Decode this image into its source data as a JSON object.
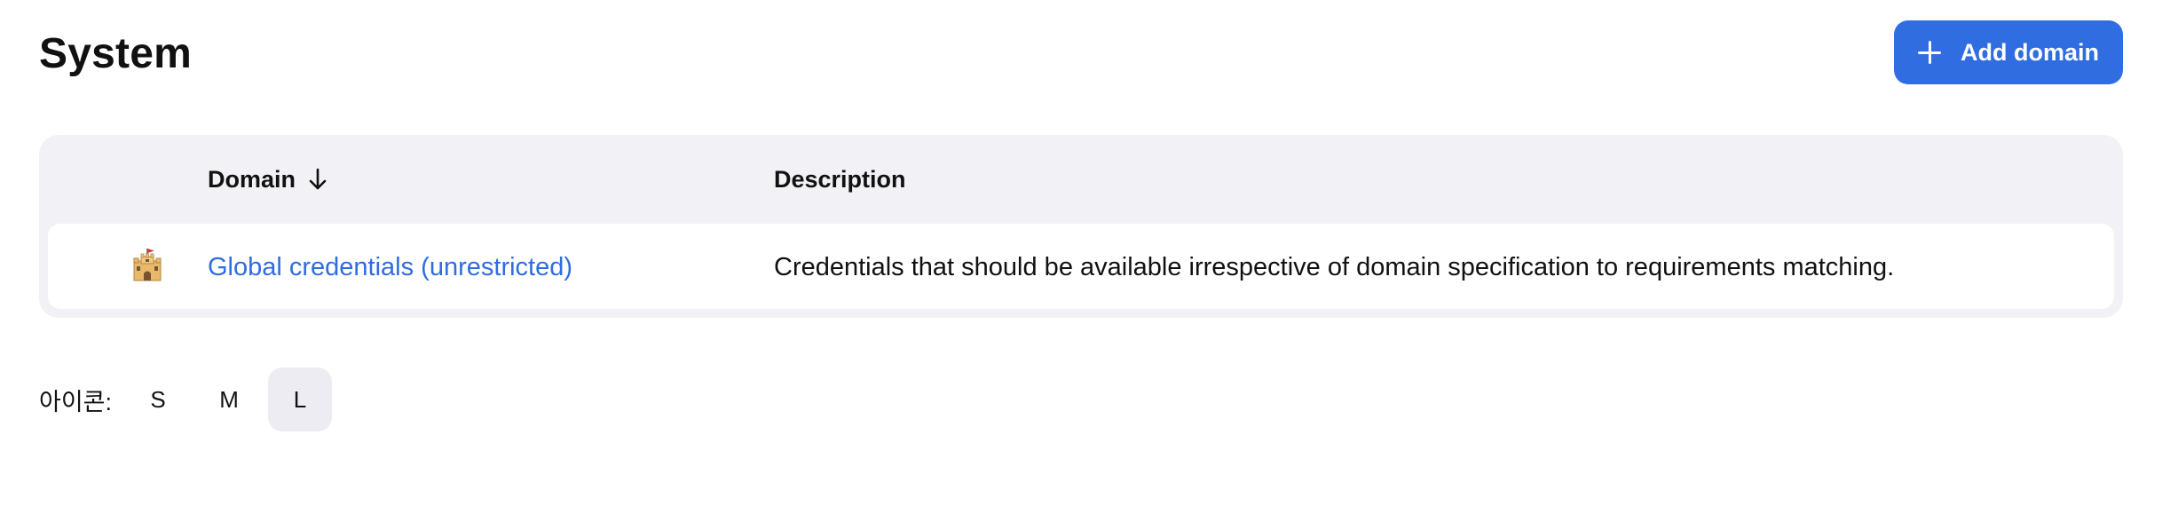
{
  "header": {
    "title": "System",
    "add_button_label": "Add domain"
  },
  "table": {
    "columns": {
      "domain": "Domain",
      "description": "Description"
    },
    "sort": {
      "column": "domain",
      "direction": "descending",
      "icon": "arrow-down-icon"
    },
    "rows": [
      {
        "icon": "castle-icon",
        "domain": "Global credentials (unrestricted)",
        "description": "Credentials that should be available irrespective of domain specification to requirements matching."
      }
    ]
  },
  "icon_size": {
    "label": "아이콘:",
    "options": [
      "S",
      "M",
      "L"
    ],
    "selected": "L"
  },
  "colors": {
    "accent": "#2f6de0",
    "card_background": "#f2f2f6",
    "selected_option_background": "#ececf2"
  }
}
